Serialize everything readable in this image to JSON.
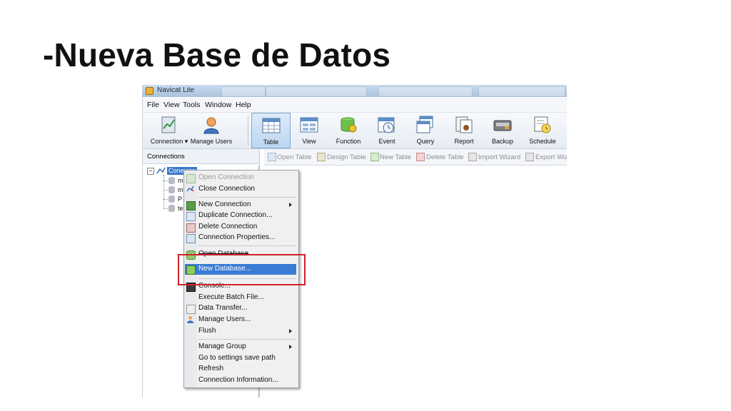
{
  "slide_title": "-Nueva Base de Datos",
  "app": {
    "window_title": "Navicat Lite",
    "menu": [
      "File",
      "View",
      "Tools",
      "Window",
      "Help"
    ],
    "toolbar": [
      {
        "label": "Connection",
        "icon": "connection-icon"
      },
      {
        "label": "Manage Users",
        "icon": "user-icon"
      },
      {
        "label": "Table",
        "icon": "table-icon"
      },
      {
        "label": "View",
        "icon": "view-icon"
      },
      {
        "label": "Function",
        "icon": "function-icon"
      },
      {
        "label": "Event",
        "icon": "event-icon"
      },
      {
        "label": "Query",
        "icon": "query-icon"
      },
      {
        "label": "Report",
        "icon": "report-icon"
      },
      {
        "label": "Backup",
        "icon": "backup-icon"
      },
      {
        "label": "Schedule",
        "icon": "schedule-icon"
      }
    ],
    "connections_header": "Connections",
    "tree": {
      "connection_label": "Conexion",
      "children": [
        "m",
        "m",
        "P",
        "te"
      ]
    },
    "object_toolbar": [
      "Open Table",
      "Design Table",
      "New Table",
      "Delete Table",
      "Import Wizard",
      "Export Wiz"
    ],
    "context_menu": [
      {
        "label": "Open Connection",
        "disabled": true
      },
      {
        "label": "Close Connection"
      },
      {
        "label": "New Connection",
        "submenu": true
      },
      {
        "label": "Duplicate Connection..."
      },
      {
        "label": "Delete Connection"
      },
      {
        "label": "Connection Properties..."
      },
      {
        "label": "Open Database"
      },
      {
        "label": "New Database...",
        "highlighted": true
      },
      {
        "label": "Console..."
      },
      {
        "label": "Execute Batch File..."
      },
      {
        "label": "Data Transfer..."
      },
      {
        "label": "Manage Users..."
      },
      {
        "label": "Flush",
        "submenu": true
      },
      {
        "label": "Manage Group",
        "submenu": true
      },
      {
        "label": "Go to settings save path"
      },
      {
        "label": "Refresh"
      },
      {
        "label": "Connection Information..."
      }
    ],
    "colors": {
      "highlight": "#3a7bd5",
      "callout": "#d0202a"
    }
  }
}
